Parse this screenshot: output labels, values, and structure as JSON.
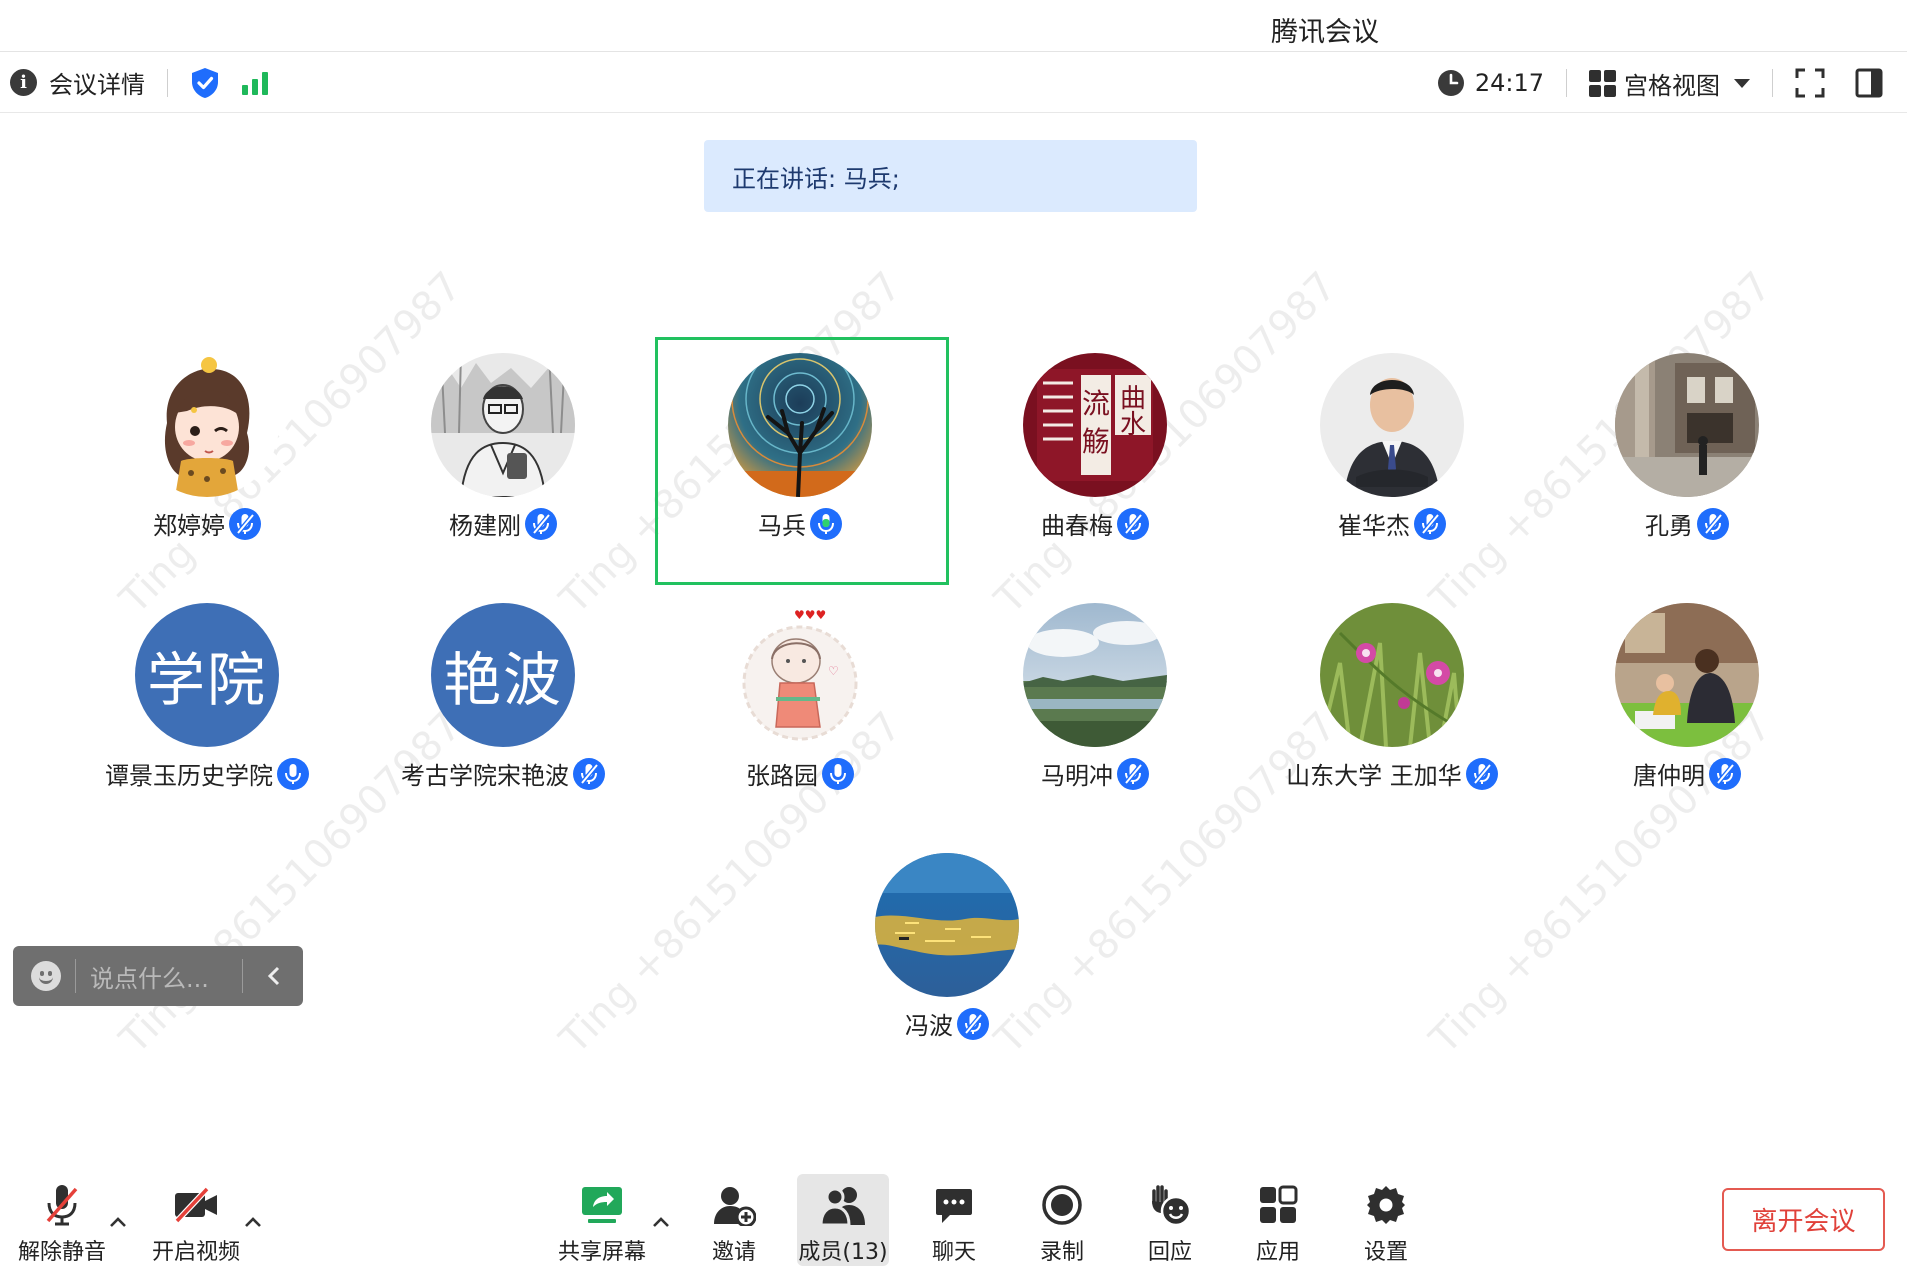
{
  "window": {
    "title": "腾讯会议"
  },
  "topbar": {
    "info_label": "会议详情",
    "timer": "24:17",
    "view_label": "宫格视图"
  },
  "speaking_banner": "正在讲话: 马兵;",
  "participants": [
    {
      "name": "郑婷婷",
      "mic": "muted",
      "avatar": "cartoon-girl"
    },
    {
      "name": "杨建刚",
      "mic": "muted",
      "avatar": "sketch-portrait"
    },
    {
      "name": "马兵",
      "mic": "speaking",
      "avatar": "tree-night-sky",
      "active": true
    },
    {
      "name": "曲春梅",
      "mic": "muted",
      "avatar": "calligraphy-stamp",
      "avatar_text": "曲水流觞"
    },
    {
      "name": "崔华杰",
      "mic": "muted",
      "avatar": "suit-portrait"
    },
    {
      "name": "孔勇",
      "mic": "muted",
      "avatar": "street-photo"
    },
    {
      "name": "谭景玉历史学院",
      "mic": "unmuted",
      "avatar": "text",
      "avatar_text": "学院"
    },
    {
      "name": "考古学院宋艳波",
      "mic": "muted",
      "avatar": "text",
      "avatar_text": "艳波"
    },
    {
      "name": "张路园",
      "mic": "unmuted",
      "avatar": "drawing-girl"
    },
    {
      "name": "马明冲",
      "mic": "muted",
      "avatar": "landscape"
    },
    {
      "name": "山东大学 王加华",
      "mic": "muted",
      "avatar": "flowers"
    },
    {
      "name": "唐仲明",
      "mic": "muted",
      "avatar": "indoor-photo"
    },
    {
      "name": "冯波",
      "mic": "muted",
      "avatar": "sea-sunset"
    }
  ],
  "watermark": "Ting +8615106907987",
  "chat": {
    "placeholder": "说点什么..."
  },
  "toolbar": {
    "unmute": "解除静音",
    "video": "开启视频",
    "share": "共享屏幕",
    "invite": "邀请",
    "members": "成员(13)",
    "chat": "聊天",
    "record": "录制",
    "react": "回应",
    "apps": "应用",
    "settings": "设置",
    "leave": "离开会议"
  },
  "colors": {
    "accent_blue": "#1f6dfc",
    "speaking_green": "#21c15f",
    "leave_red": "#e0413a",
    "banner_bg": "#dbeafe"
  }
}
